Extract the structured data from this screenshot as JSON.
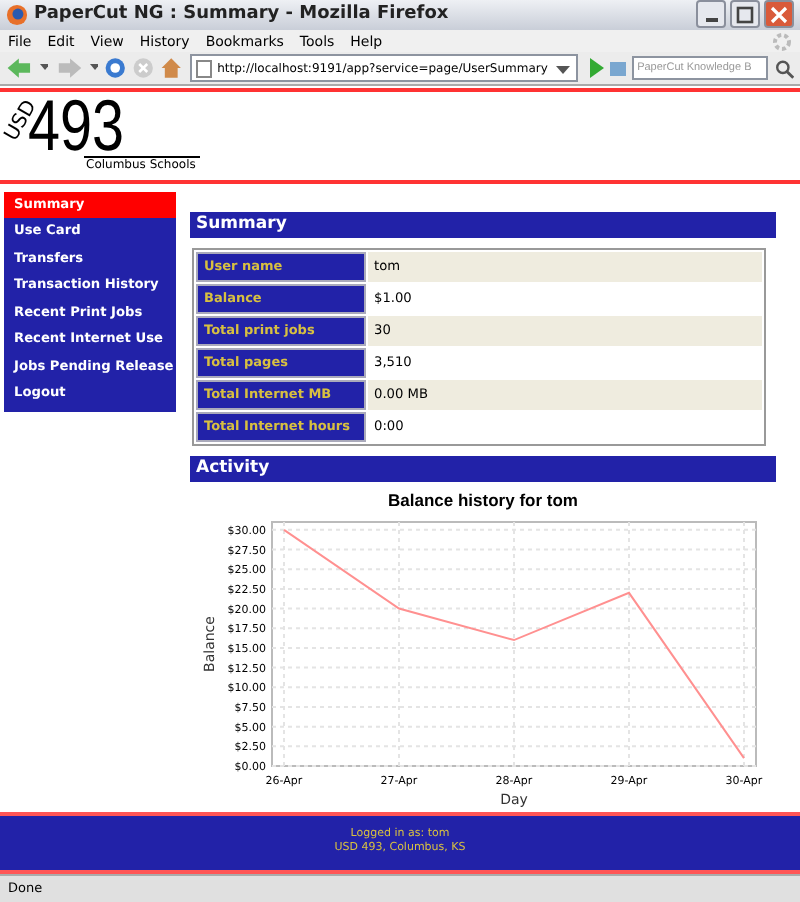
{
  "window": {
    "title": "PaperCut NG : Summary - Mozilla Firefox"
  },
  "menu": [
    "File",
    "Edit",
    "View",
    "History",
    "Bookmarks",
    "Tools",
    "Help"
  ],
  "toolbar": {
    "url": "http://localhost:9191/app?service=page/UserSummary",
    "search_placeholder": "PaperCut Knowledge B"
  },
  "logo": {
    "mark": "USD",
    "number": "493",
    "name": "Columbus Schools"
  },
  "sidebar": {
    "items": [
      {
        "label": "Summary",
        "selected": true
      },
      {
        "label": "Use Card",
        "selected": false
      },
      {
        "label": "Transfers",
        "selected": false
      },
      {
        "label": "Transaction History",
        "selected": false
      },
      {
        "label": "Recent Print Jobs",
        "selected": false
      },
      {
        "label": "Recent Internet Use",
        "selected": false
      },
      {
        "label": "Jobs Pending Release",
        "selected": false
      },
      {
        "label": "Logout",
        "selected": false
      }
    ]
  },
  "summary": {
    "heading": "Summary",
    "rows": [
      {
        "label": "User name",
        "value": "tom"
      },
      {
        "label": "Balance",
        "value": "$1.00"
      },
      {
        "label": "Total print jobs",
        "value": "30"
      },
      {
        "label": "Total pages",
        "value": "3,510"
      },
      {
        "label": "Total Internet MB",
        "value": "0.00 MB"
      },
      {
        "label": "Total Internet hours",
        "value": "0:00"
      }
    ]
  },
  "activity": {
    "heading": "Activity",
    "chart_data": {
      "type": "line",
      "title": "Balance history for tom",
      "xlabel": "Day",
      "ylabel": "Balance",
      "categories": [
        "26-Apr",
        "27-Apr",
        "28-Apr",
        "29-Apr",
        "30-Apr"
      ],
      "series": [
        {
          "color": "#ff9090",
          "values": [
            30,
            20,
            16,
            22,
            1
          ]
        }
      ],
      "grid": true,
      "ylim": [
        0,
        31
      ],
      "yticks": [
        {
          "value": 0,
          "label": "$0.00"
        },
        {
          "value": 2.5,
          "label": "$2.50"
        },
        {
          "value": 5,
          "label": "$5.00"
        },
        {
          "value": 7.5,
          "label": "$7.50"
        },
        {
          "value": 10,
          "label": "$10.00"
        },
        {
          "value": 12.5,
          "label": "$12.50"
        },
        {
          "value": 15,
          "label": "$15.00"
        },
        {
          "value": 17.5,
          "label": "$17.50"
        },
        {
          "value": 20,
          "label": "$20.00"
        },
        {
          "value": 22.5,
          "label": "$22.50"
        },
        {
          "value": 25,
          "label": "$25.00"
        },
        {
          "value": 27.5,
          "label": "$27.50"
        },
        {
          "value": 30,
          "label": "$30.00"
        }
      ]
    }
  },
  "footer": {
    "lines": [
      "Logged in as:  tom",
      "USD 493, Columbus, KS"
    ]
  },
  "status_bar": {
    "text": "Done"
  }
}
